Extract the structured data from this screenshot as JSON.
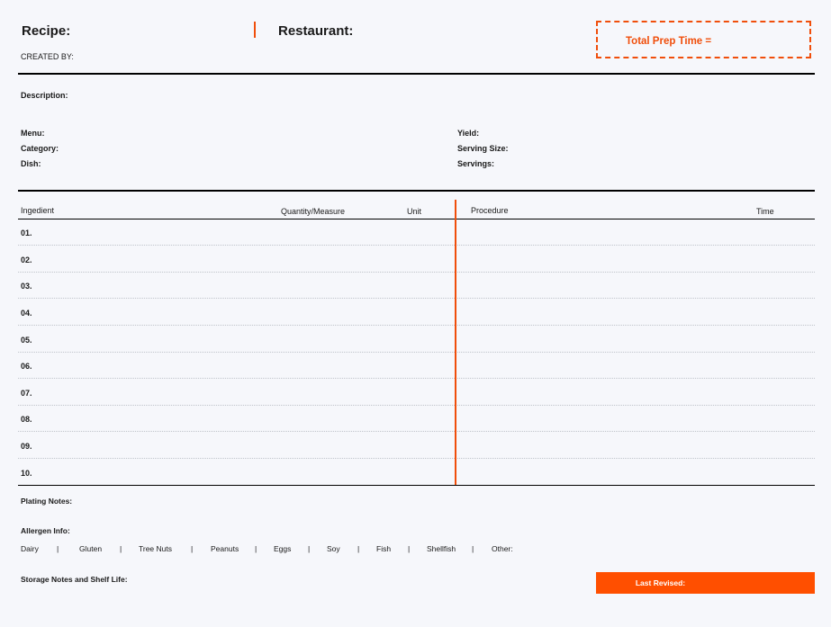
{
  "header": {
    "recipe_label": "Recipe:",
    "restaurant_label": "Restaurant:",
    "created_by_label": "CREATED BY:",
    "prep_time_label": "Total Prep Time ="
  },
  "info": {
    "description_label": "Description:",
    "menu_label": "Menu:",
    "category_label": "Category:",
    "dish_label": "Dish:",
    "yield_label": "Yield:",
    "serving_size_label": "Serving Size:",
    "servings_label": "Servings:"
  },
  "table": {
    "ingredient_header": "Ingedient",
    "quantity_header": "Quantity/Measure",
    "unit_header": "Unit",
    "procedure_header": "Procedure",
    "time_header": "Time",
    "rows": [
      "01.",
      "02.",
      "03.",
      "04.",
      "05.",
      "06.",
      "07.",
      "08.",
      "09.",
      "10."
    ]
  },
  "footer": {
    "plating_label": "Plating Notes:",
    "allergen_label": "Allergen Info:",
    "allergens": [
      "Dairy",
      "Gluten",
      "Tree Nuts",
      "Peanuts",
      "Eggs",
      "Soy",
      "Fish",
      "Shellfish",
      "Other:"
    ],
    "separator": "|",
    "storage_label": "Storage Notes and Shelf Life:",
    "last_revised_label": "Last Revised:"
  },
  "colors": {
    "accent": "#f04e0b",
    "background": "#f6f7fb",
    "rule": "#000000"
  }
}
